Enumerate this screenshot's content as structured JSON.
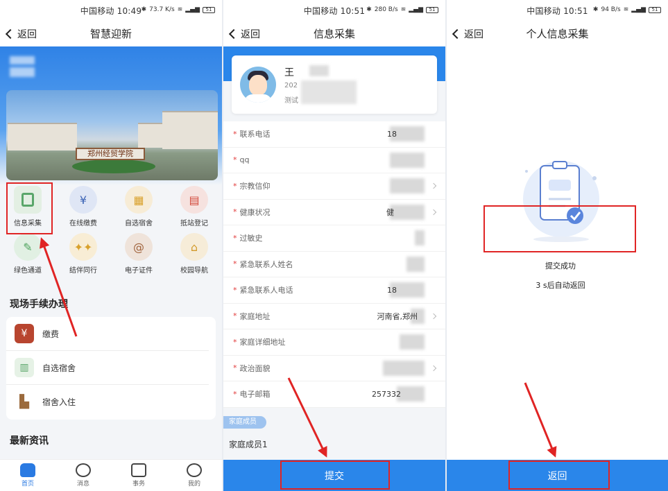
{
  "status": {
    "p1": {
      "carrier_time": "中国移动 10:49",
      "speed": "73.7 K/s",
      "battery": "51"
    },
    "p2": {
      "carrier_time": "中国移动 10:51",
      "speed": "280 B/s",
      "battery": "51"
    },
    "p3": {
      "carrier_time": "中国移动 10:51",
      "speed": "94 B/s",
      "battery": "51"
    }
  },
  "back_label": "返回",
  "p1": {
    "title": "智慧迎新",
    "campus_gate_text": "郑州经贸学院",
    "grid": [
      {
        "label": "信息采集",
        "icon": "info-collect-icon",
        "color": "#5aa66a",
        "bg": "#e3efe3"
      },
      {
        "label": "在线缴费",
        "icon": "money-bag-icon",
        "color": "#3b63b5",
        "bg": "#dfe6f5"
      },
      {
        "label": "自选宿舍",
        "icon": "dorm-icon",
        "color": "#d9a12b",
        "bg": "#f7ecd6"
      },
      {
        "label": "抵站登记",
        "icon": "station-register-icon",
        "color": "#d2483a",
        "bg": "#f6e2df"
      },
      {
        "label": "绿色通道",
        "icon": "green-channel-icon",
        "color": "#4ea35d",
        "bg": "#e1f0e3"
      },
      {
        "label": "结伴同行",
        "icon": "companion-icon",
        "color": "#d8a12c",
        "bg": "#f8edd5"
      },
      {
        "label": "电子证件",
        "icon": "e-card-icon",
        "color": "#a0623b",
        "bg": "#efe3da"
      },
      {
        "label": "校园导航",
        "icon": "campus-nav-icon",
        "color": "#d29a2a",
        "bg": "#f6ecd8"
      }
    ],
    "section_onsite": "现场手续办理",
    "onsite_items": [
      {
        "label": "缴费",
        "icon": "yuan-icon",
        "color": "#b8452f"
      },
      {
        "label": "自选宿舍",
        "icon": "dorm-small-icon",
        "color": "#5aa66a"
      },
      {
        "label": "宿舍入住",
        "icon": "checkin-icon",
        "color": "#9b6a3c"
      }
    ],
    "section_news": "最新资讯",
    "tabs": [
      {
        "label": "首页",
        "icon": "home-icon",
        "active": true
      },
      {
        "label": "消息",
        "icon": "message-icon",
        "active": false
      },
      {
        "label": "事务",
        "icon": "affairs-icon",
        "active": false
      },
      {
        "label": "我的",
        "icon": "profile-icon",
        "active": false
      }
    ]
  },
  "p2": {
    "title": "信息采集",
    "profile": {
      "name": "王",
      "line1": "202",
      "line2": "测试"
    },
    "fields": [
      {
        "label": "联系电话",
        "value": "18",
        "arrow": false
      },
      {
        "label": "qq",
        "value": "",
        "arrow": false
      },
      {
        "label": "宗教信仰",
        "value": "",
        "arrow": true
      },
      {
        "label": "健康状况",
        "value": "健",
        "arrow": true
      },
      {
        "label": "过敏史",
        "value": "",
        "arrow": false
      },
      {
        "label": "紧急联系人姓名",
        "value": "",
        "arrow": false
      },
      {
        "label": "紧急联系人电话",
        "value": "18",
        "arrow": false
      },
      {
        "label": "家庭地址",
        "value": "河南省,郑州",
        "arrow": true
      },
      {
        "label": "家庭详细地址",
        "value": "",
        "arrow": false
      },
      {
        "label": "政治面貌",
        "value": "",
        "arrow": true
      },
      {
        "label": "电子邮箱",
        "value": "257332",
        "arrow": false
      }
    ],
    "family_section": "家庭成员",
    "family_item": "家庭成员1",
    "submit_label": "提交"
  },
  "p3": {
    "title": "个人信息采集",
    "success_text": "提交成功",
    "countdown_text": "3 s后自动返回",
    "return_label": "返回"
  },
  "colors": {
    "primary": "#2a86ea",
    "highlight": "#e02424",
    "required": "#e23b3b"
  }
}
